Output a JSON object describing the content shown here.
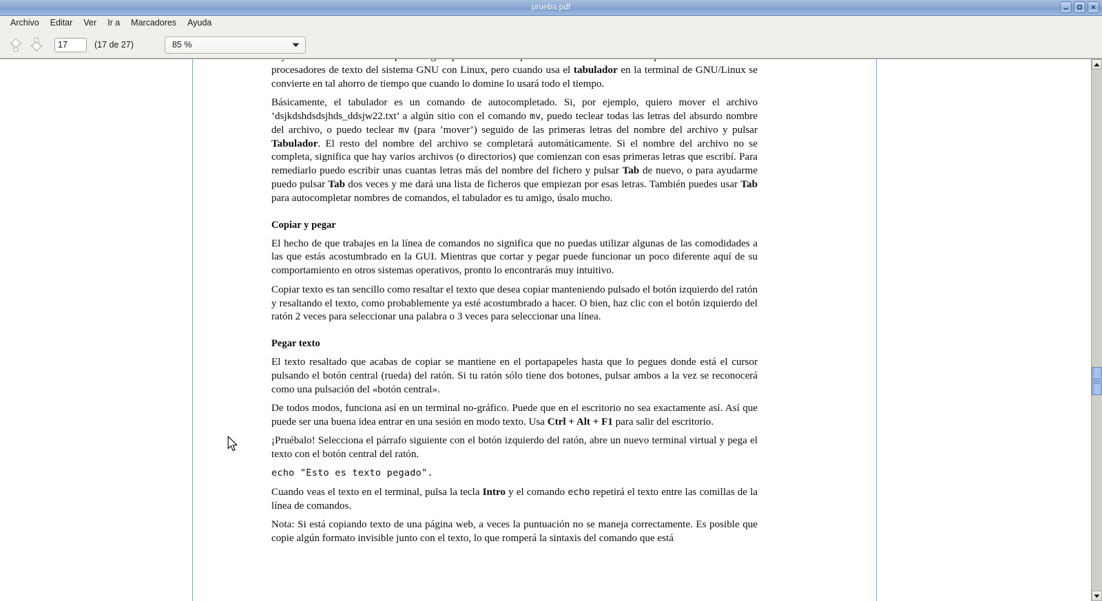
{
  "window": {
    "title": "prueba.pdf",
    "controls": [
      {
        "name": "minimize",
        "glyph": "_"
      },
      {
        "name": "maximize",
        "glyph": "□"
      },
      {
        "name": "close",
        "glyph": "X"
      }
    ]
  },
  "menubar": {
    "items": [
      {
        "label": "Archivo"
      },
      {
        "label": "Editar"
      },
      {
        "label": "Ver"
      },
      {
        "label": "Ir a"
      },
      {
        "label": "Marcadores"
      },
      {
        "label": "Ayuda"
      }
    ]
  },
  "toolbar": {
    "previous_page_icon": "page-up-icon",
    "next_page_icon": "page-down-icon",
    "page_number_value": "17",
    "page_number_placeholder": "",
    "page_count_label": "(17 de 27)",
    "zoom_value": "85 %",
    "zoom_dropdown_icon": "chevron-down-icon"
  },
  "document": {
    "clipped_top_line": "haya usado esta tecla antes para sangrar palabras en un procesador de textos. Todavía puede hacer esto en",
    "paragraph_1_line2": "los procesadores de texto del sistema GNU con Linux, pero cuando usa el ",
    "paragraph_1_bold1": "tabulador",
    "paragraph_1_line2b": " en la terminal de GNU/Linux se convierte en tal ahorro de tiempo que cuando lo domine lo usará todo el tiempo.",
    "paragraph_2_a": "Básicamente, el tabulador es un comando de autocompletado. Si, por ejemplo, quiero mover el archivo ’dsjkdshdsdsjhds_ddsjw22.txt’ a algún sitio con el comando ",
    "paragraph_2_mono1": "mv",
    "paragraph_2_b": ", puedo teclear todas las letras del absurdo nombre del archivo, o puedo teclear ",
    "paragraph_2_mono2": "mv",
    "paragraph_2_c": " (para ’mover’) seguido de las primeras letras del nombre del archivo y pulsar ",
    "paragraph_2_bold1": "Tabulador",
    "paragraph_2_d": ". El resto del nombre del archivo se completará automáticamente. Si el nombre del archivo no se completa, significa que hay varios archivos (o directorios) que comienzan con esas primeras letras que escribí. Para remediarlo puedo escribir unas cuantas letras más del nombre del fichero y pulsar ",
    "paragraph_2_bold2": "Tab",
    "paragraph_2_e": " de nuevo, o para ayudarme puedo pulsar ",
    "paragraph_2_bold3": "Tab",
    "paragraph_2_f": " dos veces y me dará una lista de ficheros que empiezan por esas letras. También puedes usar ",
    "paragraph_2_bold4": "Tab",
    "paragraph_2_g": " para autocompletar nombres de comandos, el tabulador es tu amigo, úsalo mucho.",
    "heading_1": "Copiar y pegar",
    "paragraph_3": "El hecho de que trabajes en la línea de comandos no significa que no puedas utilizar algunas de las comodidades a las que estás acostumbrado en la GUI. Mientras que cortar y pegar puede funcionar un poco diferente aquí de su comportamiento en otros sistemas operativos, pronto lo encontrarás muy intuitivo.",
    "paragraph_4": "Copiar texto es tan sencillo como resaltar el texto que desea copiar manteniendo pulsado el botón izquierdo del ratón y resaltando el texto, como probablemente ya esté acostumbrado a hacer. O bien, haz clic con el botón izquierdo del ratón 2 veces para seleccionar una palabra o 3 veces para seleccionar una línea.",
    "heading_2": "Pegar texto",
    "paragraph_5": "El texto resaltado que acabas de copiar se mantiene en el portapapeles hasta que lo pegues donde está el cursor pulsando el botón central (rueda) del ratón. Si tu ratón sólo tiene dos botones, pulsar ambos a la vez se reconocerá como una pulsación del «botón central».",
    "paragraph_6_a": "De todos modos, funciona así en un terminal no-gráfico. Puede que en el escritorio no sea exactamente así. Así que puede ser una buena idea entrar en una sesión en modo texto. Usa ",
    "paragraph_6_bold": "Ctrl + Alt + F1",
    "paragraph_6_b": " para salir del escritorio.",
    "paragraph_7": "¡Pruébalo! Selecciona el párrafo siguiente con el botón izquierdo del ratón, abre un nuevo terminal virtual y pega el texto con el botón central del ratón.",
    "code_line": "echo \"Esto es texto pegado\".",
    "paragraph_8_a": "Cuando veas el texto en el terminal, pulsa la tecla ",
    "paragraph_8_bold": "Intro",
    "paragraph_8_b": " y el comando ",
    "paragraph_8_mono": "echo",
    "paragraph_8_c": " repetirá el texto entre las comillas de la línea de comandos.",
    "paragraph_9": "Nota: Si está copiando texto de una página web, a veces la puntuación no se maneja correctamente. Es posible que copie algún formato invisible junto con el texto, lo que romperá la sintaxis del comando que está"
  },
  "scrollbar": {
    "up_icon": "scroll-up-icon",
    "down_icon": "scroll-down-icon",
    "thumb_grip_icon": "grip-icon"
  },
  "colors": {
    "titlebar_blue": "#8ba9d4",
    "toolbar_bg": "#efefeb",
    "page_edge_blue": "#7fa6cf",
    "scroll_thumb_blue": "#9dbde9"
  }
}
